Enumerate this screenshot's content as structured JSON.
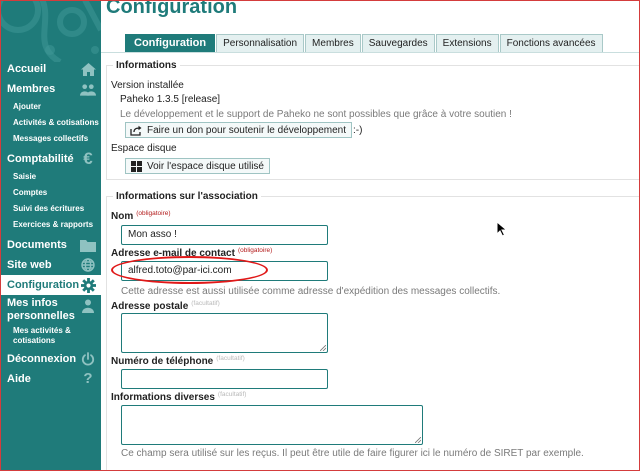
{
  "sidebar": {
    "items": [
      {
        "label": "Accueil",
        "icon": "home-icon"
      },
      {
        "label": "Membres",
        "icon": "users-icon"
      },
      {
        "label": "Comptabilité",
        "icon": "euro-icon"
      },
      {
        "label": "Documents",
        "icon": "folder-icon"
      },
      {
        "label": "Site web",
        "icon": "globe-icon"
      },
      {
        "label": "Configuration",
        "icon": "gear-icon",
        "active": true
      },
      {
        "label": "Mes infos personnelles",
        "icon": "user-icon"
      },
      {
        "label": "Déconnexion",
        "icon": "power-icon"
      },
      {
        "label": "Aide",
        "icon": "help-icon"
      }
    ],
    "membres_sub": [
      "Ajouter",
      "Activités & cotisations",
      "Messages collectifs"
    ],
    "compta_sub": [
      "Saisie",
      "Comptes",
      "Suivi des écritures",
      "Exercices & rapports"
    ],
    "perso_sub": [
      "Mes activités &",
      "cotisations"
    ]
  },
  "page": {
    "title": "Configuration"
  },
  "tabs": [
    "Configuration",
    "Personnalisation",
    "Membres",
    "Sauvegardes",
    "Extensions",
    "Fonctions avancées"
  ],
  "informations": {
    "legend": "Informations",
    "version_label": "Version installée",
    "version_value": "Paheko 1.3.5 [release]",
    "support_text": "Le développement et le support de Paheko ne sont possibles que grâce à votre soutien !",
    "donate_button": "Faire un don pour soutenir le développement",
    "smiley": ":-)",
    "disk_label": "Espace disque",
    "disk_button": "Voir l'espace disque utilisé"
  },
  "association": {
    "legend": "Informations sur l'association",
    "name_label": "Nom",
    "required_tag": "(obligatoire)",
    "optional_tag": "(facultatif)",
    "name_value": "Mon asso !",
    "email_label": "Adresse e-mail de contact",
    "email_value": "alfred.toto@par-ici.com",
    "email_help": "Cette adresse est aussi utilisée comme adresse d'expédition des messages collectifs.",
    "address_label": "Adresse postale",
    "phone_label": "Numéro de téléphone",
    "misc_label": "Informations diverses",
    "misc_help": "Ce champ sera utilisé sur les reçus. Il peut être utile de faire figurer ici le numéro de SIRET par exemple."
  },
  "colors": {
    "brand": "#1f7b7a",
    "annotation": "#e01818"
  }
}
